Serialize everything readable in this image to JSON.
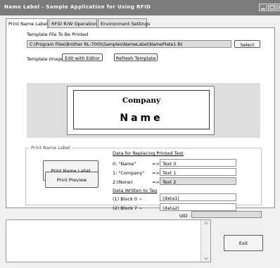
{
  "window": {
    "title": "Name Label - Sample Application for Using RFID"
  },
  "tabs": [
    {
      "label": "Print Name Label"
    },
    {
      "label": "RFID R/W Operation"
    },
    {
      "label": "Environment Settings"
    }
  ],
  "template": {
    "file_label": "Template File To Be Printed",
    "file_path": "C:\\Program Files\\Brother RL-700S\\Samples\\NameLabel\\NamePlate1.lbl",
    "select_label": "Select",
    "image_label": "Template Image",
    "edit_label": "Edit with Editor",
    "refresh_label": "Refresh Template",
    "preview_company": "Company",
    "preview_name": "Name"
  },
  "print_group": {
    "legend": "Print Name Label",
    "print_button": "Print Name Label",
    "preview_button": "Print Preview",
    "replace_heading": "Data for Replacing Printed Text",
    "replace_rows": [
      {
        "key": "0: \"Name\"",
        "arrow": "=>",
        "value": "Text 0"
      },
      {
        "key": "1: \"Company\"",
        "arrow": "=>",
        "value": "Text 1"
      },
      {
        "key": "2:(None)",
        "arrow": "=>",
        "value": "Text 2"
      }
    ],
    "tag_heading": "Data Written to Tag",
    "tag_rows": [
      {
        "key": "(1) Block 0 ~",
        "value": "(data1)"
      },
      {
        "key": "(2) Block 7 ~",
        "value": "(data2)"
      }
    ],
    "uid_label": "UID",
    "uid_value": ""
  },
  "footer": {
    "exit_label": "Exit",
    "log_text": ""
  }
}
